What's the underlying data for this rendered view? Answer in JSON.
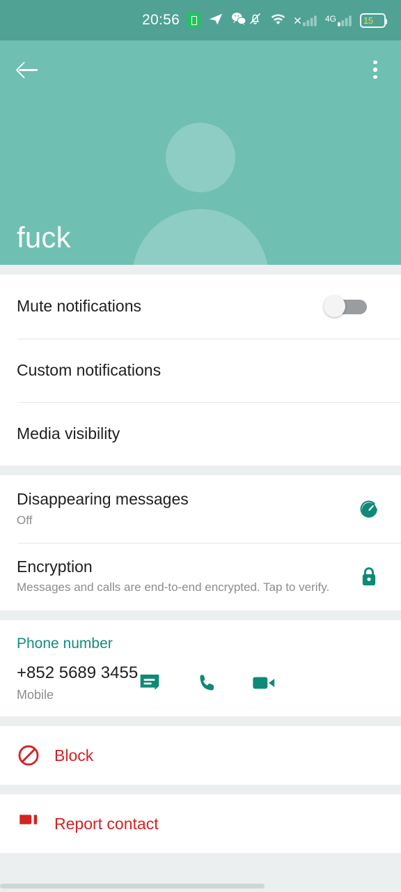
{
  "status_bar": {
    "time": "20:56",
    "battery_percent": "15",
    "icons": [
      "battery-saver-icon",
      "telegram-icon",
      "wechat-icon",
      "bell-muted-icon",
      "wifi-icon",
      "signal-no-service-icon",
      "signal-4g-icon",
      "battery-icon"
    ]
  },
  "header": {
    "back_label": "back-arrow",
    "menu_label": "overflow-menu",
    "contact_name": "fuck",
    "avatar": "default-person-avatar",
    "bg_color": "#6fbfb2",
    "status_bg_color": "#4fa294"
  },
  "notifications_section": {
    "mute": {
      "title": "Mute notifications",
      "enabled": false
    },
    "custom": {
      "title": "Custom notifications"
    },
    "media": {
      "title": "Media visibility"
    }
  },
  "privacy_section": {
    "disappearing": {
      "title": "Disappearing messages",
      "value": "Off",
      "icon": "timer-icon"
    },
    "encryption": {
      "title": "Encryption",
      "description": "Messages and calls are end-to-end encrypted. Tap to verify.",
      "icon": "lock-icon"
    }
  },
  "phone_section": {
    "label": "Phone number",
    "number": "+852 5689 3455",
    "type": "Mobile",
    "actions": [
      "message-icon",
      "call-icon",
      "video-call-icon"
    ]
  },
  "actions_section": {
    "block": {
      "label": "Block",
      "icon": "block-icon"
    },
    "report": {
      "label": "Report contact",
      "icon": "report-icon"
    }
  },
  "colors": {
    "accent_green": "#128c7e",
    "danger_red": "#d32323",
    "divider": "#e6e6e6",
    "page_bg": "#eceff0"
  }
}
